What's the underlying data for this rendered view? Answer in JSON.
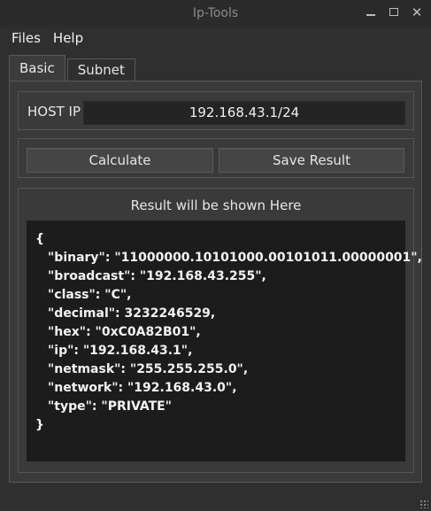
{
  "window": {
    "title": "Ip-Tools"
  },
  "menu": {
    "items": [
      "Files",
      "Help"
    ]
  },
  "tabs": [
    {
      "label": "Basic",
      "active": true
    },
    {
      "label": "Subnet",
      "active": false
    }
  ],
  "host": {
    "label": "HOST IP",
    "value": "192.168.43.1/24"
  },
  "buttons": {
    "calculate": "Calculate",
    "save": "Save Result"
  },
  "result": {
    "title": "Result will be shown Here",
    "lines": [
      "{",
      "\"binary\": \"11000000.10101000.00101011.00000001\",",
      "\"broadcast\": \"192.168.43.255\",",
      "\"class\": \"C\",",
      "\"decimal\": 3232246529,",
      "\"hex\": \"0xC0A82B01\",",
      "\"ip\": \"192.168.43.1\",",
      "\"netmask\": \"255.255.255.0\",",
      "\"network\": \"192.168.43.0\",",
      "\"type\": \"PRIVATE\"",
      "}"
    ]
  },
  "colors": {
    "background": "#2f2f2f",
    "panel": "#3a3a3a",
    "input": "#242424",
    "result_bg": "#1c1c1c"
  }
}
